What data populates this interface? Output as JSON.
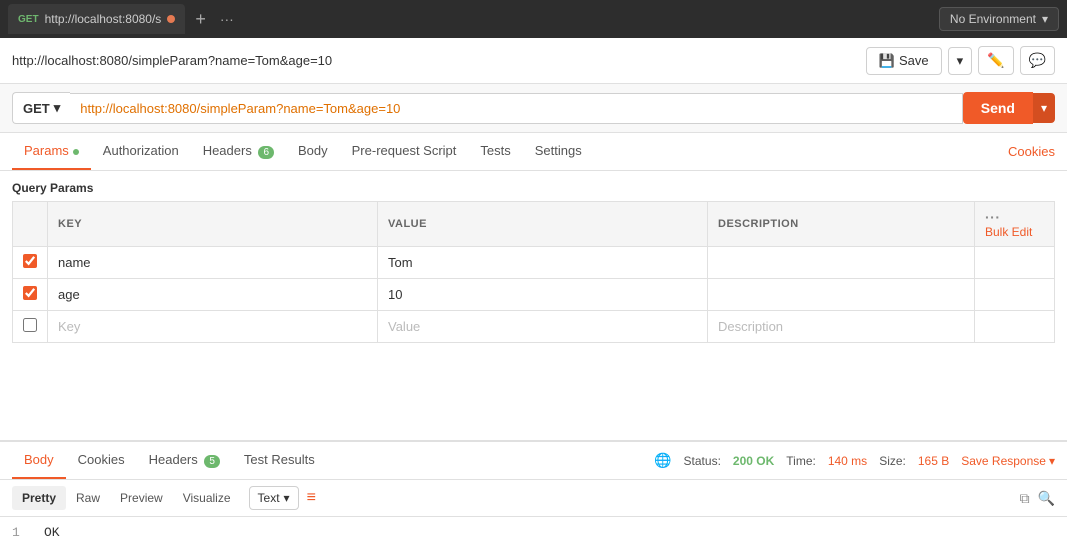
{
  "topBar": {
    "tab": {
      "method": "GET",
      "url": "http://localhost:8080/s",
      "hasDot": true
    },
    "environment": {
      "label": "No Environment"
    }
  },
  "addressBar": {
    "title": "http://localhost:8080/simpleParam?name=Tom&age=10",
    "save_label": "Save",
    "chevron_down": "▾"
  },
  "requestBar": {
    "method": "GET",
    "url": "http://localhost:8080/simpleParam?name=Tom&age=10",
    "send_label": "Send"
  },
  "tabs": [
    {
      "id": "params",
      "label": "Params",
      "active": true,
      "hasDot": true
    },
    {
      "id": "authorization",
      "label": "Authorization",
      "active": false
    },
    {
      "id": "headers",
      "label": "Headers",
      "badge": "6",
      "active": false
    },
    {
      "id": "body",
      "label": "Body",
      "active": false
    },
    {
      "id": "prerequest",
      "label": "Pre-request Script",
      "active": false
    },
    {
      "id": "tests",
      "label": "Tests",
      "active": false
    },
    {
      "id": "settings",
      "label": "Settings",
      "active": false
    }
  ],
  "cookies_link": "Cookies",
  "queryParams": {
    "title": "Query Params",
    "columns": {
      "key": "KEY",
      "value": "VALUE",
      "description": "DESCRIPTION",
      "bulk_edit": "Bulk Edit"
    },
    "rows": [
      {
        "checked": true,
        "key": "name",
        "value": "Tom",
        "description": ""
      },
      {
        "checked": true,
        "key": "age",
        "value": "10",
        "description": ""
      }
    ],
    "newRow": {
      "key_placeholder": "Key",
      "value_placeholder": "Value",
      "description_placeholder": "Description"
    }
  },
  "responseTabs": [
    {
      "id": "body",
      "label": "Body",
      "active": true
    },
    {
      "id": "cookies",
      "label": "Cookies"
    },
    {
      "id": "headers",
      "label": "Headers",
      "badge": "5"
    },
    {
      "id": "testresults",
      "label": "Test Results"
    }
  ],
  "responseMeta": {
    "status_label": "Status:",
    "status_code": "200 OK",
    "time_label": "Time:",
    "time_value": "140 ms",
    "size_label": "Size:",
    "size_value": "165 B",
    "save_response": "Save Response"
  },
  "formatBar": {
    "tabs": [
      "Pretty",
      "Raw",
      "Preview",
      "Visualize"
    ],
    "active_tab": "Pretty",
    "type": "Text",
    "chevron": "▾"
  },
  "codeOutput": {
    "line": "1",
    "content": "OK"
  }
}
